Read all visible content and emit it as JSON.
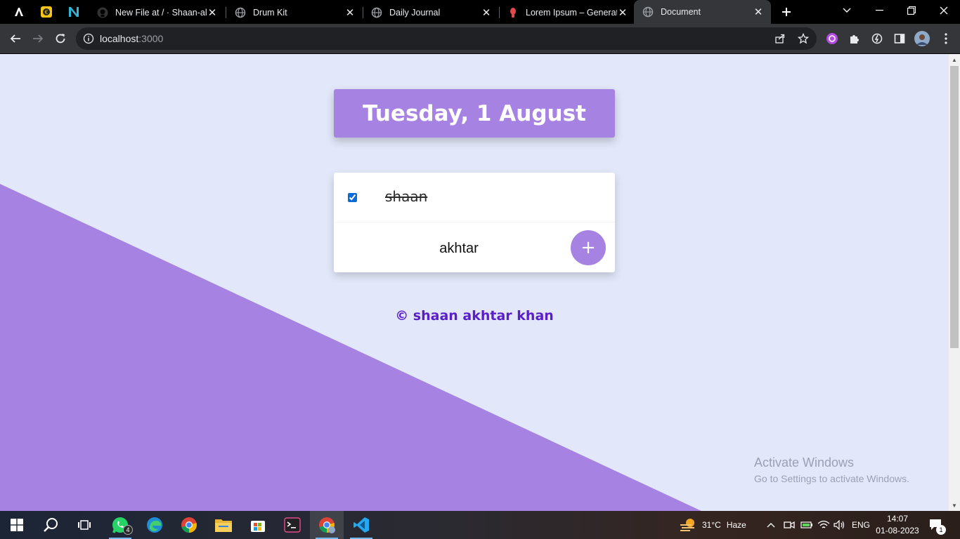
{
  "browser": {
    "pinned_tabs": [
      {
        "icon": "lambda-app-icon"
      },
      {
        "icon": "coin-app-icon"
      },
      {
        "icon": "n-app-icon"
      }
    ],
    "tabs": [
      {
        "title": "New File at / · Shaan-akh",
        "icon": "github-icon"
      },
      {
        "title": "Drum Kit",
        "icon": "globe-icon"
      },
      {
        "title": "Daily Journal",
        "icon": "globe-icon"
      },
      {
        "title": "Lorem Ipsum – Generato",
        "icon": "lorem-icon"
      },
      {
        "title": "Document",
        "icon": "globe-icon",
        "active": true
      }
    ],
    "address": {
      "host": "localhost",
      "port": ":3000"
    }
  },
  "page": {
    "heading": "Tuesday, 1 August",
    "items": [
      {
        "text": "shaan",
        "checked": true
      }
    ],
    "new_item_value": "akhtar",
    "add_button_label": "+",
    "footer": "© shaan akhtar khan",
    "colors": {
      "accent": "#a683e3",
      "background": "#e2e8fa",
      "footer": "#5a1fc9"
    }
  },
  "watermark": {
    "line1": "Activate Windows",
    "line2": "Go to Settings to activate Windows."
  },
  "taskbar": {
    "apps": [
      "windows-start",
      "search",
      "task-view",
      "whatsapp",
      "edge",
      "chrome",
      "file-explorer",
      "microsoft-store",
      "terminal",
      "chrome-profile",
      "vscode"
    ],
    "whatsapp_badge": "4",
    "weather": {
      "temp": "31°C",
      "condition": "Haze"
    },
    "language": "ENG",
    "time": "14:07",
    "date": "01-08-2023",
    "notification_count": "1"
  }
}
